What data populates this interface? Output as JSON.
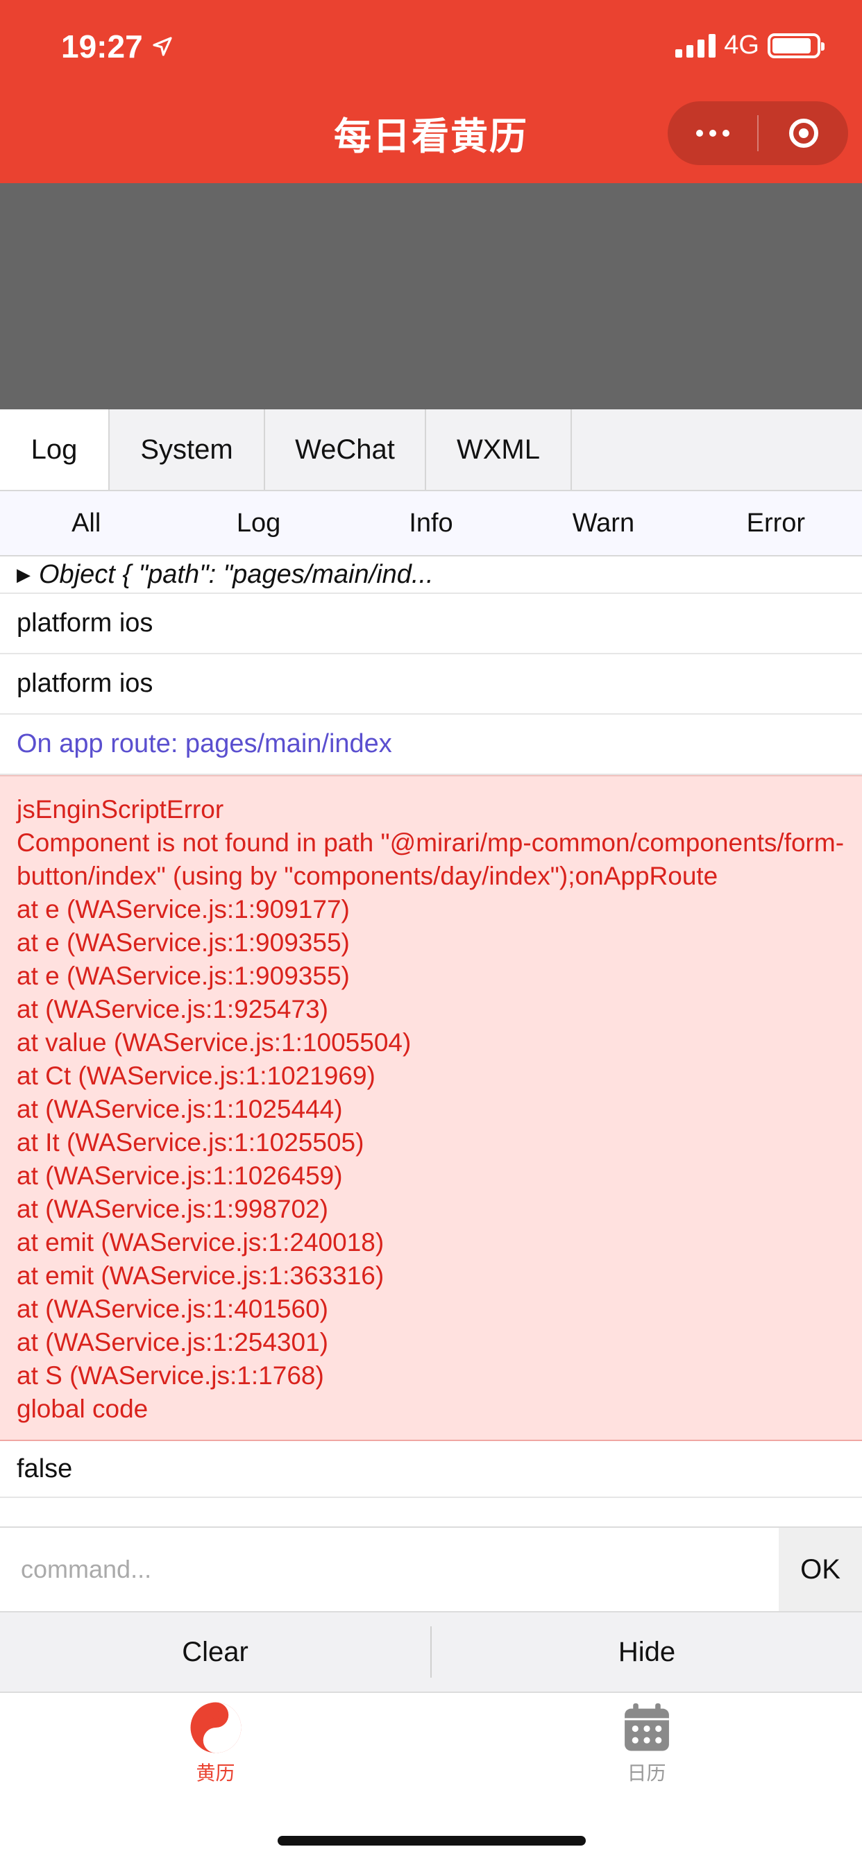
{
  "status": {
    "time": "19:27",
    "network": "4G"
  },
  "nav": {
    "title": "每日看黄历"
  },
  "tabs": [
    {
      "label": "Log",
      "active": true
    },
    {
      "label": "System",
      "active": false
    },
    {
      "label": "WeChat",
      "active": false
    },
    {
      "label": "WXML",
      "active": false
    }
  ],
  "filters": [
    "All",
    "Log",
    "Info",
    "Warn",
    "Error"
  ],
  "log": {
    "object_preview": "Object { \"path\": \"pages/main/ind...",
    "rows": [
      "platform ios",
      "platform ios"
    ],
    "route": "On app route: pages/main/index",
    "error_lines": [
      "jsEnginScriptError",
      "Component is not found in path \"@mirari/mp-common/components/form-button/index\" (using by \"components/day/index\");onAppRoute",
      "at e (WAService.js:1:909177)",
      "at e (WAService.js:1:909355)",
      "at e (WAService.js:1:909355)",
      "at (WAService.js:1:925473)",
      "at value (WAService.js:1:1005504)",
      "at Ct (WAService.js:1:1021969)",
      "at (WAService.js:1:1025444)",
      "at It (WAService.js:1:1025505)",
      "at (WAService.js:1:1026459)",
      "at (WAService.js:1:998702)",
      "at emit (WAService.js:1:240018)",
      "at emit (WAService.js:1:363316)",
      "at (WAService.js:1:401560)",
      "at (WAService.js:1:254301)",
      "at S (WAService.js:1:1768)",
      "global code"
    ],
    "last_value": "false"
  },
  "command": {
    "placeholder": "command...",
    "ok_label": "OK"
  },
  "actions": {
    "clear_label": "Clear",
    "hide_label": "Hide"
  },
  "tabbar": {
    "items": [
      {
        "label": "黄历",
        "icon": "yin-yang-icon",
        "active": true
      },
      {
        "label": "日历",
        "icon": "calendar-icon",
        "active": false
      }
    ]
  },
  "colors": {
    "brand": "#ea4230",
    "error_bg": "#ffe1df",
    "error_text": "#d9221c",
    "route_text": "#5a4fcf"
  }
}
